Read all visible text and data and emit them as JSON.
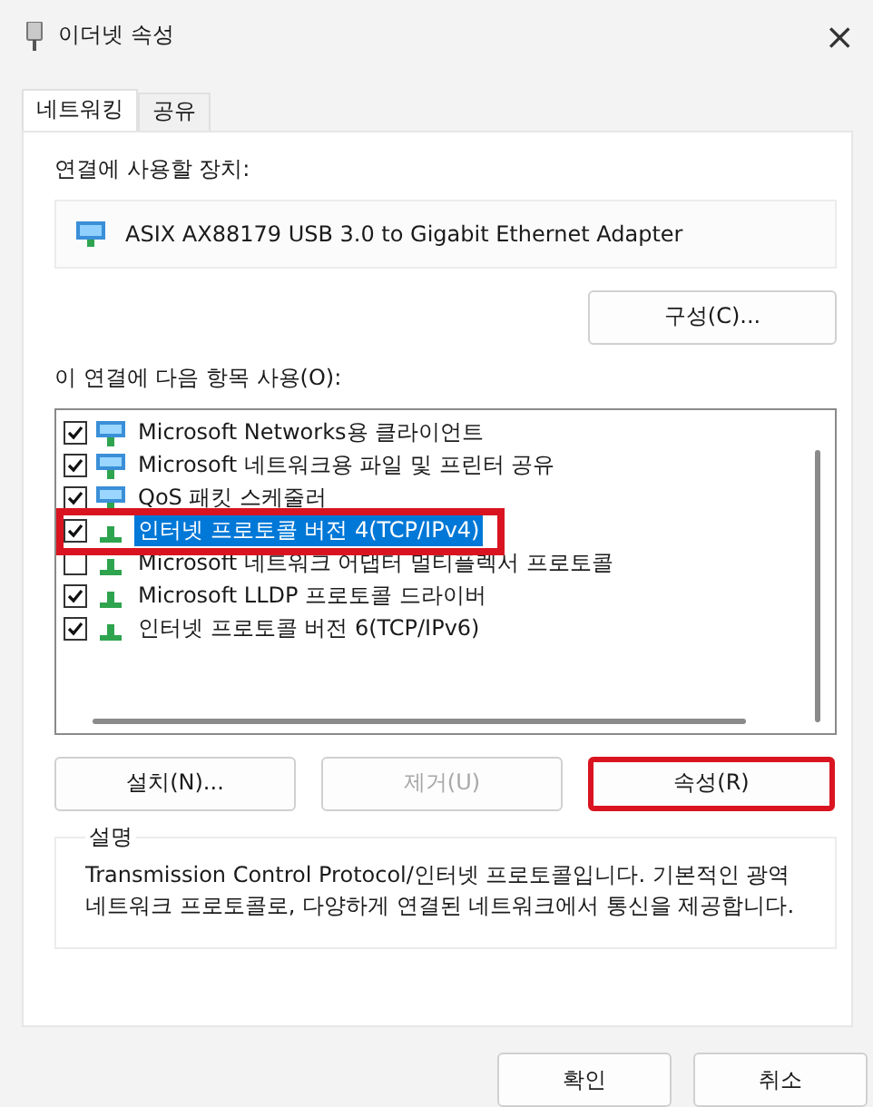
{
  "window": {
    "title": "이더넷 속성",
    "close": "×"
  },
  "tabs": [
    {
      "label": "네트워킹",
      "selected": true
    },
    {
      "label": "공유",
      "selected": false
    }
  ],
  "device": {
    "label": "연결에 사용할 장치:",
    "name": "ASIX AX88179 USB 3.0 to Gigabit Ethernet Adapter",
    "configure": "구성(C)..."
  },
  "items_label": "이 연결에 다음 항목 사용(O):",
  "items": [
    {
      "label": "Microsoft Networks용 클라이언트",
      "kind": "client",
      "checked": true,
      "selected": false,
      "highlighted": false
    },
    {
      "label": "Microsoft 네트워크용 파일 및 프린터 공유",
      "kind": "service",
      "checked": true,
      "selected": false,
      "highlighted": false
    },
    {
      "label": "QoS 패킷 스케줄러",
      "kind": "service",
      "checked": true,
      "selected": false,
      "highlighted": false
    },
    {
      "label": "인터넷 프로토콜 버전 4(TCP/IPv4)",
      "kind": "protocol",
      "checked": true,
      "selected": true,
      "highlighted": true
    },
    {
      "label": "Microsoft 네트워크 어댑터 멀티플렉서 프로토콜",
      "kind": "protocol",
      "checked": false,
      "selected": false,
      "highlighted": false
    },
    {
      "label": "Microsoft LLDP 프로토콜 드라이버",
      "kind": "protocol",
      "checked": true,
      "selected": false,
      "highlighted": false
    },
    {
      "label": "인터넷 프로토콜 버전 6(TCP/IPv6)",
      "kind": "protocol",
      "checked": true,
      "selected": false,
      "highlighted": false
    }
  ],
  "item_buttons": [
    {
      "label": "설치(N)...",
      "disabled": false,
      "highlighted": false
    },
    {
      "label": "제거(U)",
      "disabled": true,
      "highlighted": false
    },
    {
      "label": "속성(R)",
      "disabled": false,
      "highlighted": true
    }
  ],
  "description": {
    "title": "설명",
    "text": "Transmission Control Protocol/인터넷 프로토콜입니다. 기본적인 광역 네트워크 프로토콜로, 다양하게 연결된 네트워크에서 통신을 제공합니다."
  },
  "buttons": [
    "확인",
    "취소"
  ]
}
